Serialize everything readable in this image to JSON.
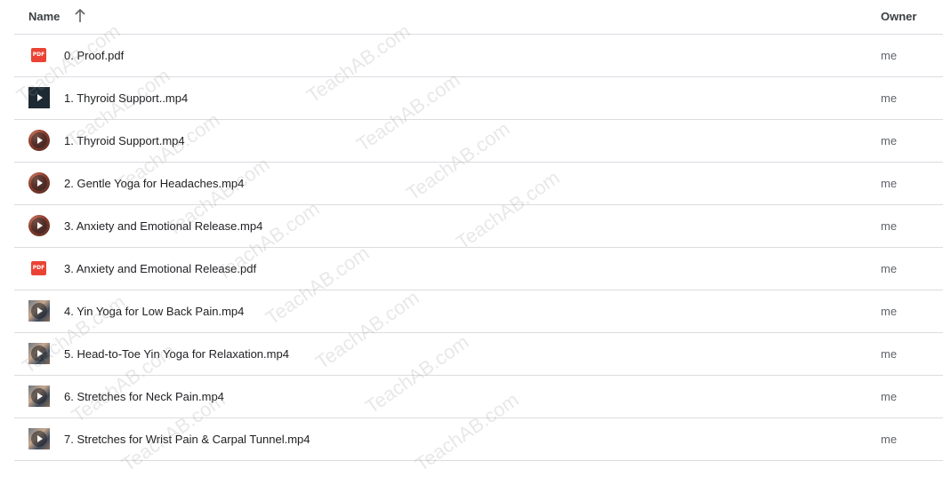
{
  "header": {
    "name_label": "Name",
    "owner_label": "Owner",
    "sort_icon": "arrow-up-icon"
  },
  "files": [
    {
      "name": "0. Proof.pdf",
      "owner": "me",
      "icon": "pdf-icon",
      "icon_text": "PDF"
    },
    {
      "name": "1. Thyroid Support..mp4",
      "owner": "me",
      "icon": "video-icon"
    },
    {
      "name": "1. Thyroid Support.mp4",
      "owner": "me",
      "icon": "video-icon"
    },
    {
      "name": "2. Gentle Yoga for Headaches.mp4",
      "owner": "me",
      "icon": "video-icon"
    },
    {
      "name": "3. Anxiety and Emotional Release.mp4",
      "owner": "me",
      "icon": "video-icon"
    },
    {
      "name": "3. Anxiety and Emotional Release.pdf",
      "owner": "me",
      "icon": "pdf-icon",
      "icon_text": "PDF"
    },
    {
      "name": "4. Yin Yoga for Low Back Pain.mp4",
      "owner": "me",
      "icon": "video-icon"
    },
    {
      "name": "5. Head-to-Toe Yin Yoga for Relaxation.mp4",
      "owner": "me",
      "icon": "video-icon"
    },
    {
      "name": "6. Stretches for Neck Pain.mp4",
      "owner": "me",
      "icon": "video-icon"
    },
    {
      "name": "7. Stretches for Wrist Pain & Carpal Tunnel.mp4",
      "owner": "me",
      "icon": "video-icon"
    }
  ],
  "watermark_text": "TeachAB.com",
  "colors": {
    "pdf_red": "#ea4335",
    "divider": "#dadce0",
    "text_primary": "#202124",
    "text_secondary": "#5f6368"
  }
}
